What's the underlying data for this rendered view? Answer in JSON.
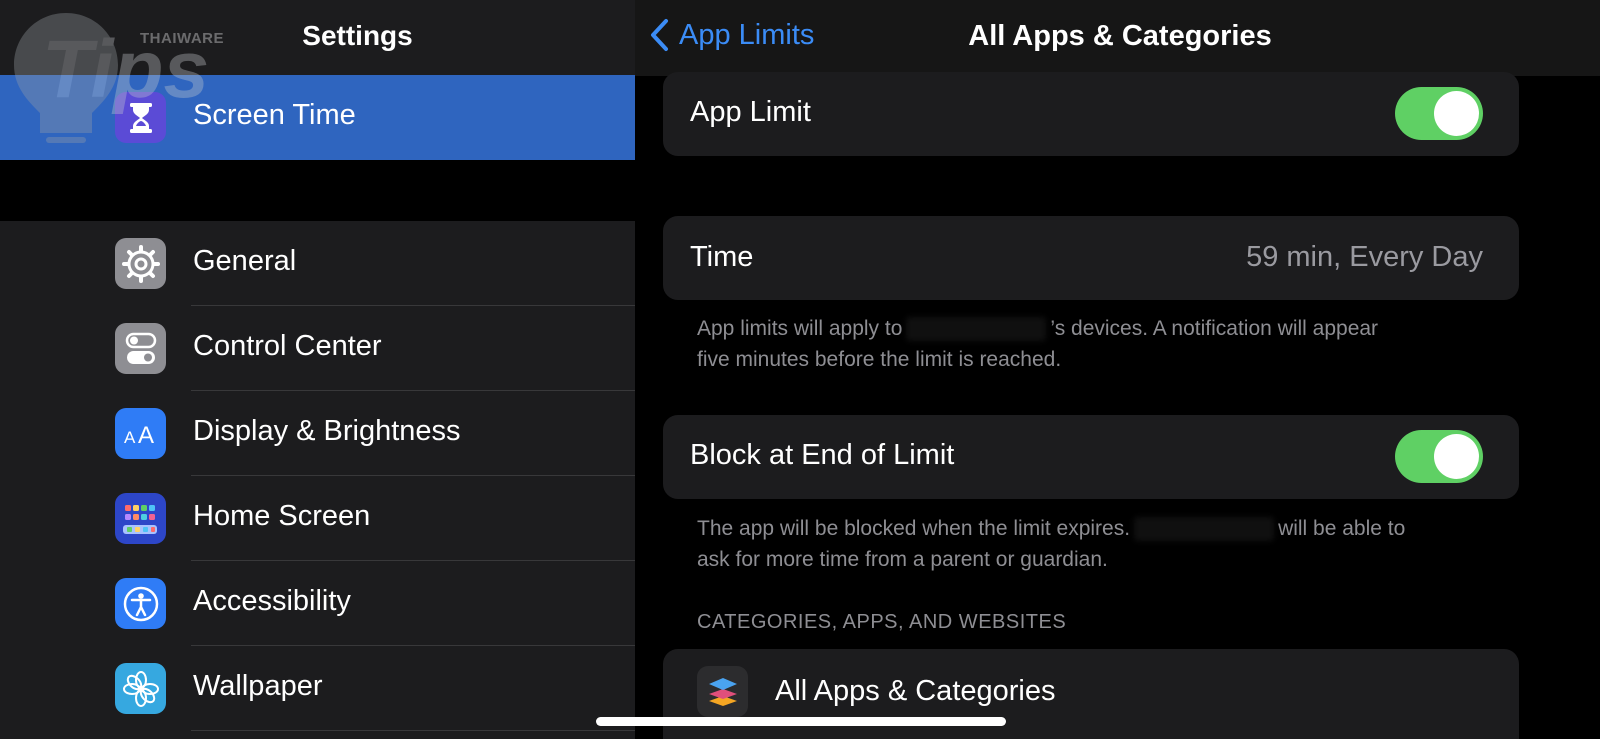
{
  "sidebar": {
    "title": "Settings",
    "selected": {
      "label": "Screen Time",
      "icon": "hourglass-icon"
    },
    "items": [
      {
        "label": "General",
        "icon": "gear-icon"
      },
      {
        "label": "Control Center",
        "icon": "toggles-icon"
      },
      {
        "label": "Display & Brightness",
        "icon": "text-size-icon"
      },
      {
        "label": "Home Screen",
        "icon": "home-grid-icon"
      },
      {
        "label": "Accessibility",
        "icon": "accessibility-icon"
      },
      {
        "label": "Wallpaper",
        "icon": "flower-icon"
      }
    ]
  },
  "detail": {
    "back_label": "App Limits",
    "title": "All Apps & Categories",
    "app_limit": {
      "label": "App Limit",
      "on": true
    },
    "time": {
      "label": "Time",
      "value": "59 min, Every Day"
    },
    "time_note": {
      "before": "App limits will apply to",
      "after": "’s devices. A notification will appear",
      "line2": "five minutes before the limit is reached."
    },
    "block": {
      "label": "Block at End of Limit",
      "on": true
    },
    "block_note": {
      "before": "The app will be blocked when the limit expires.",
      "after": "will be able to",
      "line2": "ask for more time from a parent or guardian."
    },
    "section_header": "CATEGORIES, APPS, AND WEBSITES",
    "category_item": {
      "label": "All Apps & Categories",
      "icon": "stack-layers-icon"
    }
  },
  "watermark": {
    "brand": "THAIWARE",
    "logo_text": "Tips"
  },
  "colors": {
    "accent": "#3b8cf6",
    "selected_row": "#2f65bf",
    "toggle_on": "#5fd064",
    "background": "#000000",
    "grouped_cell": "#1c1c1e",
    "secondary_text": "#8e8e93"
  }
}
